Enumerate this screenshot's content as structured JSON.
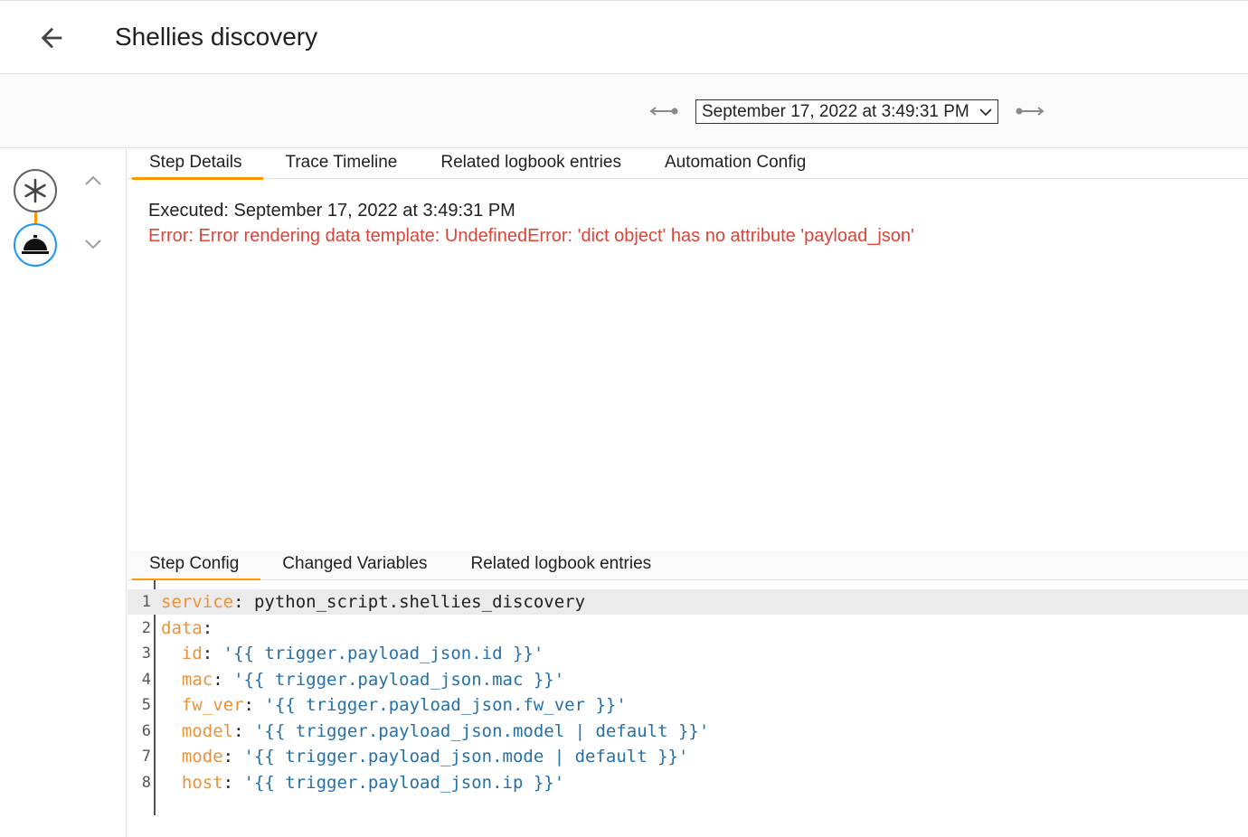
{
  "header": {
    "title": "Shellies discovery"
  },
  "trace_selector": {
    "selected": "September 17, 2022 at 3:49:31 PM"
  },
  "top_tabs": [
    {
      "label": "Step Details"
    },
    {
      "label": "Trace Timeline"
    },
    {
      "label": "Related logbook entries"
    },
    {
      "label": "Automation Config"
    }
  ],
  "details": {
    "executed": "Executed: September 17, 2022 at 3:49:31 PM",
    "error": "Error: Error rendering data template: UndefinedError: 'dict object' has no attribute 'payload_json'"
  },
  "bottom_tabs": [
    {
      "label": "Step Config"
    },
    {
      "label": "Changed Variables"
    },
    {
      "label": "Related logbook entries"
    }
  ],
  "code": {
    "lines": [
      {
        "num": "1",
        "indent": "",
        "key": "service",
        "sep": ": ",
        "value": "python_script.shellies_discovery",
        "value_type": "plain"
      },
      {
        "num": "2",
        "indent": "",
        "key": "data",
        "sep": ":",
        "value": "",
        "value_type": "plain"
      },
      {
        "num": "3",
        "indent": "  ",
        "key": "id",
        "sep": ": ",
        "value": "'{{ trigger.payload_json.id }}'",
        "value_type": "string"
      },
      {
        "num": "4",
        "indent": "  ",
        "key": "mac",
        "sep": ": ",
        "value": "'{{ trigger.payload_json.mac }}'",
        "value_type": "string"
      },
      {
        "num": "5",
        "indent": "  ",
        "key": "fw_ver",
        "sep": ": ",
        "value": "'{{ trigger.payload_json.fw_ver }}'",
        "value_type": "string"
      },
      {
        "num": "6",
        "indent": "  ",
        "key": "model",
        "sep": ": ",
        "value": "'{{ trigger.payload_json.model | default }}'",
        "value_type": "string"
      },
      {
        "num": "7",
        "indent": "  ",
        "key": "mode",
        "sep": ": ",
        "value": "'{{ trigger.payload_json.mode | default }}'",
        "value_type": "string"
      },
      {
        "num": "8",
        "indent": "  ",
        "key": "host",
        "sep": ": ",
        "value": "'{{ trigger.payload_json.ip }}'",
        "value_type": "string"
      }
    ]
  },
  "colors": {
    "accent": "#ff9800",
    "error": "#db4437",
    "yaml_key": "#e9923a",
    "yaml_string": "#2470a8",
    "selected_node": "#2196f3"
  },
  "icons": {
    "back": "arrow-left-icon",
    "prev_trace": "arrow-left-bar-icon",
    "next_trace": "arrow-right-bar-icon",
    "trigger_node": "asterisk-icon",
    "action_node": "room-service-icon",
    "step_up": "chevron-up-icon",
    "step_down": "chevron-down-icon"
  }
}
